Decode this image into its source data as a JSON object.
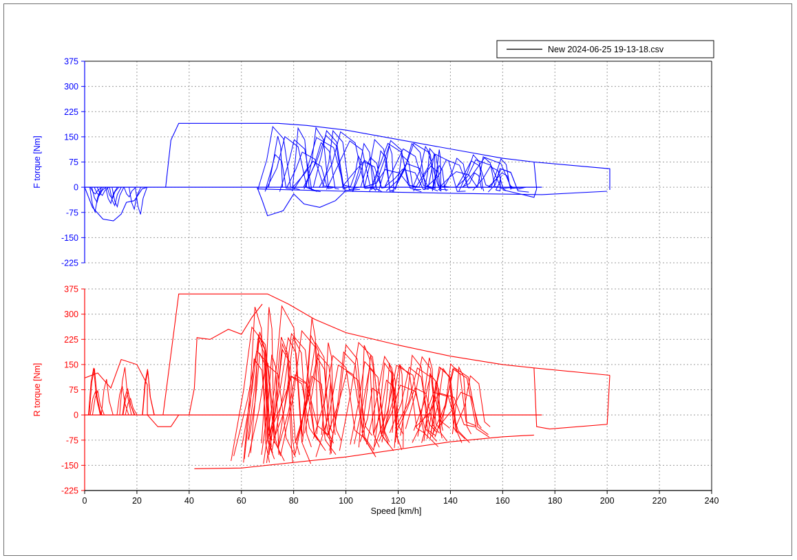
{
  "chart_data": {
    "type": "line",
    "legend": {
      "label": "New 2024-06-25 19-13-18.csv",
      "placement": "top-right",
      "line_color": "#000000"
    },
    "grid": true,
    "x_axis": {
      "label": "Speed [km/h]",
      "range": [
        0,
        240
      ],
      "ticks": [
        "0",
        "20",
        "40",
        "60",
        "80",
        "100",
        "120",
        "140",
        "160",
        "180",
        "200",
        "220",
        "240"
      ],
      "color": "#000000"
    },
    "panels": [
      {
        "name": "front",
        "ylabel": "F torque [Nm]",
        "color": "#0000ff",
        "ylim": [
          -225,
          375
        ],
        "yticks": [
          "375",
          "300",
          "225",
          "150",
          "75",
          "0",
          "-75",
          "-150",
          "-225"
        ],
        "envelope": {
          "drive_upper": [
            [
              31,
              0
            ],
            [
              33,
              140
            ],
            [
              36,
              190
            ],
            [
              74,
              190
            ],
            [
              85,
              184
            ],
            [
              100,
              170
            ],
            [
              120,
              142
            ],
            [
              140,
              114
            ],
            [
              160,
              86
            ],
            [
              172,
              75
            ]
          ],
          "regen_lower": [
            [
              66,
              -5
            ],
            [
              100,
              -12
            ],
            [
              140,
              -18
            ],
            [
              175,
              -22
            ],
            [
              200,
              -12
            ]
          ],
          "outer": [
            [
              160,
              -8
            ],
            [
              172,
              -30
            ],
            [
              173,
              -5
            ],
            [
              172,
              75
            ],
            [
              201,
              55
            ],
            [
              201,
              -8
            ]
          ],
          "low_speed_braking": [
            [
              0,
              0
            ],
            [
              3,
              -60
            ],
            [
              7,
              -95
            ],
            [
              11,
              -100
            ],
            [
              14,
              -80
            ],
            [
              16,
              -45
            ],
            [
              19,
              -40
            ],
            [
              22,
              -5
            ],
            [
              24,
              0
            ]
          ],
          "mid_decel": [
            [
              66,
              0
            ],
            [
              68,
              -40
            ],
            [
              70,
              -85
            ],
            [
              76,
              -70
            ],
            [
              80,
              -20
            ],
            [
              84,
              -50
            ],
            [
              90,
              -60
            ],
            [
              96,
              -40
            ],
            [
              100,
              -10
            ]
          ]
        }
      },
      {
        "name": "rear",
        "ylabel": "R torque [Nm]",
        "color": "#ff0000",
        "ylim": [
          -225,
          375
        ],
        "yticks": [
          "375",
          "300",
          "225",
          "150",
          "75",
          "0",
          "-75",
          "-150",
          "-225"
        ],
        "envelope": {
          "drive_upper": [
            [
              30,
              0
            ],
            [
              32,
              120
            ],
            [
              36,
              360
            ],
            [
              70,
              360
            ],
            [
              78,
              330
            ],
            [
              88,
              285
            ],
            [
              100,
              245
            ],
            [
              120,
              208
            ],
            [
              140,
              175
            ],
            [
              160,
              150
            ],
            [
              172,
              140
            ],
            [
              201,
              118
            ]
          ],
          "regen_lower": [
            [
              42,
              -160
            ],
            [
              60,
              -158
            ],
            [
              100,
              -125
            ],
            [
              140,
              -80
            ],
            [
              160,
              -65
            ],
            [
              172,
              -60
            ]
          ],
          "outer": [
            [
              172,
              140
            ],
            [
              173,
              -35
            ],
            [
              178,
              -42
            ],
            [
              200,
              -28
            ],
            [
              201,
              118
            ]
          ],
          "low_speed": [
            [
              0,
              110
            ],
            [
              5,
              125
            ],
            [
              10,
              80
            ],
            [
              14,
              165
            ],
            [
              20,
              150
            ],
            [
              24,
              90
            ],
            [
              24,
              0
            ],
            [
              28,
              -35
            ],
            [
              33,
              -35
            ],
            [
              36,
              0
            ]
          ],
          "mid_accel": [
            [
              40,
              0
            ],
            [
              42,
              80
            ],
            [
              43,
              230
            ],
            [
              48,
              225
            ],
            [
              55,
              255
            ],
            [
              60,
              240
            ],
            [
              64,
              290
            ],
            [
              68,
              330
            ]
          ]
        }
      }
    ]
  }
}
